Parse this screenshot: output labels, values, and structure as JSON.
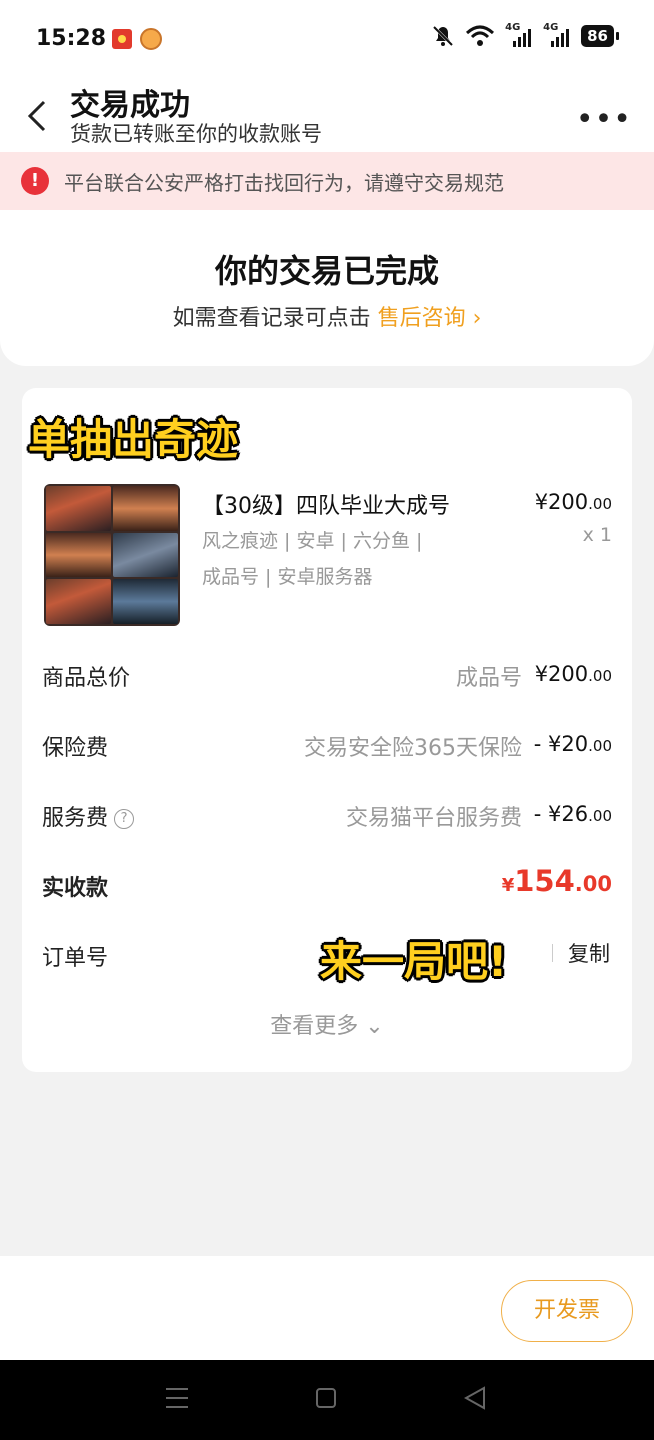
{
  "status_bar": {
    "time": "15:28",
    "battery": "86",
    "icons": [
      "red-envelope-notification-icon",
      "cat-app-notification-icon",
      "bell-muted-icon",
      "wifi-icon",
      "signal-4g-icon",
      "signal-4g-icon",
      "battery-icon"
    ]
  },
  "header": {
    "title": "交易成功",
    "subtitle": "货款已转账至你的收款账号",
    "back_icon": "chevron-left-icon",
    "more_icon": "more-dots-icon"
  },
  "warning": {
    "text": "平台联合公安严格打击找回行为，请遵守交易规范",
    "icon": "alert-icon",
    "color": "#e8323a"
  },
  "status_card": {
    "title": "你的交易已完成",
    "subtitle_prefix": "如需查看记录可点击",
    "link": "售后咨询 ›",
    "link_color": "#f0a020"
  },
  "order": {
    "overlay_top": "单抽出奇迹",
    "overlay_bottom": "来一局吧!",
    "item": {
      "name": "【30级】四队毕业大成号",
      "tags_line1": "风之痕迹 | 安卓 | 六分鱼 |",
      "tags_line2": "成品号 | 安卓服务器",
      "price_int": "¥200",
      "price_dec": ".00",
      "qty": "x 1"
    },
    "rows": {
      "total_label": "商品总价",
      "total_desc": "成品号",
      "total_int": "¥200",
      "total_dec": ".00",
      "insurance_label": "保险费",
      "insurance_desc": "交易安全险365天保险",
      "insurance_int": "- ¥20",
      "insurance_dec": ".00",
      "service_label": "服务费",
      "service_desc": "交易猫平台服务费",
      "service_int": "- ¥26",
      "service_dec": ".00",
      "net_label": "实收款",
      "net_yuan": "¥",
      "net_int": "154",
      "net_dec": ".00",
      "net_color": "#e8392a",
      "order_label": "订单号",
      "copy": "复制"
    },
    "see_more": "查看更多 ⌄"
  },
  "bottom": {
    "invoice_button": "开发票",
    "accent": "#e89a20"
  },
  "nav": {
    "icons": [
      "menu-icon",
      "home-icon",
      "back-triangle-icon"
    ]
  }
}
